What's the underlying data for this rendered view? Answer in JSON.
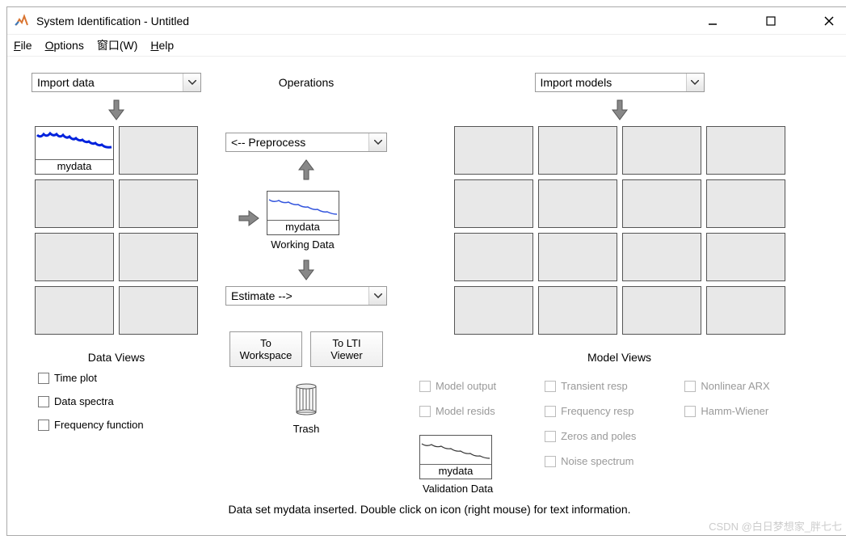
{
  "window": {
    "title": "System Identification - Untitled"
  },
  "menu": {
    "file": "File",
    "options": "Options",
    "window": "窗口(W)",
    "help": "Help"
  },
  "importData": {
    "label": "Import data"
  },
  "importModels": {
    "label": "Import models"
  },
  "dataSlots": {
    "slot1_label": "mydata"
  },
  "operations": {
    "title": "Operations",
    "preprocess_label": "<-- Preprocess",
    "working_data_name": "mydata",
    "working_data_label": "Working Data",
    "estimate_label": "Estimate -->",
    "to_workspace": "To Workspace",
    "to_lti": "To LTI Viewer",
    "trash_label": "Trash"
  },
  "dataViews": {
    "title": "Data Views",
    "time_plot": "Time plot",
    "data_spectra": "Data spectra",
    "freq_function": "Frequency function"
  },
  "modelViews": {
    "title": "Model Views",
    "model_output": "Model output",
    "model_resids": "Model resids",
    "transient_resp": "Transient resp",
    "frequency_resp": "Frequency resp",
    "zeros_poles": "Zeros and poles",
    "noise_spectrum": "Noise spectrum",
    "nonlinear_arx": "Nonlinear ARX",
    "hamm_wiener": "Hamm-Wiener"
  },
  "validation": {
    "name": "mydata",
    "label": "Validation Data"
  },
  "status": "Data set mydata inserted.  Double click on icon (right mouse) for text information.",
  "watermark": "CSDN @白日梦想家_胖七七"
}
